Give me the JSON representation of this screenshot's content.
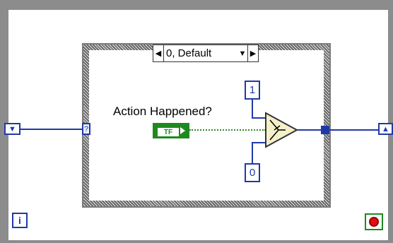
{
  "case_structure": {
    "selected_case_label": "0, Default",
    "selector_terminal": "?",
    "decrement_glyph": "◀",
    "increment_glyph": "▶",
    "dropdown_glyph": "▼"
  },
  "boolean_control": {
    "label": "Action Happened?",
    "type_label": "TF"
  },
  "select_function": {
    "true_constant": "1",
    "false_constant": "0"
  },
  "loop": {
    "iteration_terminal": "i",
    "left_shift_register_glyph": "▼",
    "right_shift_register_glyph": "▲",
    "stop_icon": "stop-icon"
  },
  "colors": {
    "numeric_wire": "#1f3aa8",
    "boolean_wire": "#2e8b2e",
    "loop_frame": "#8c8c8c",
    "stop_red": "#e01010"
  }
}
